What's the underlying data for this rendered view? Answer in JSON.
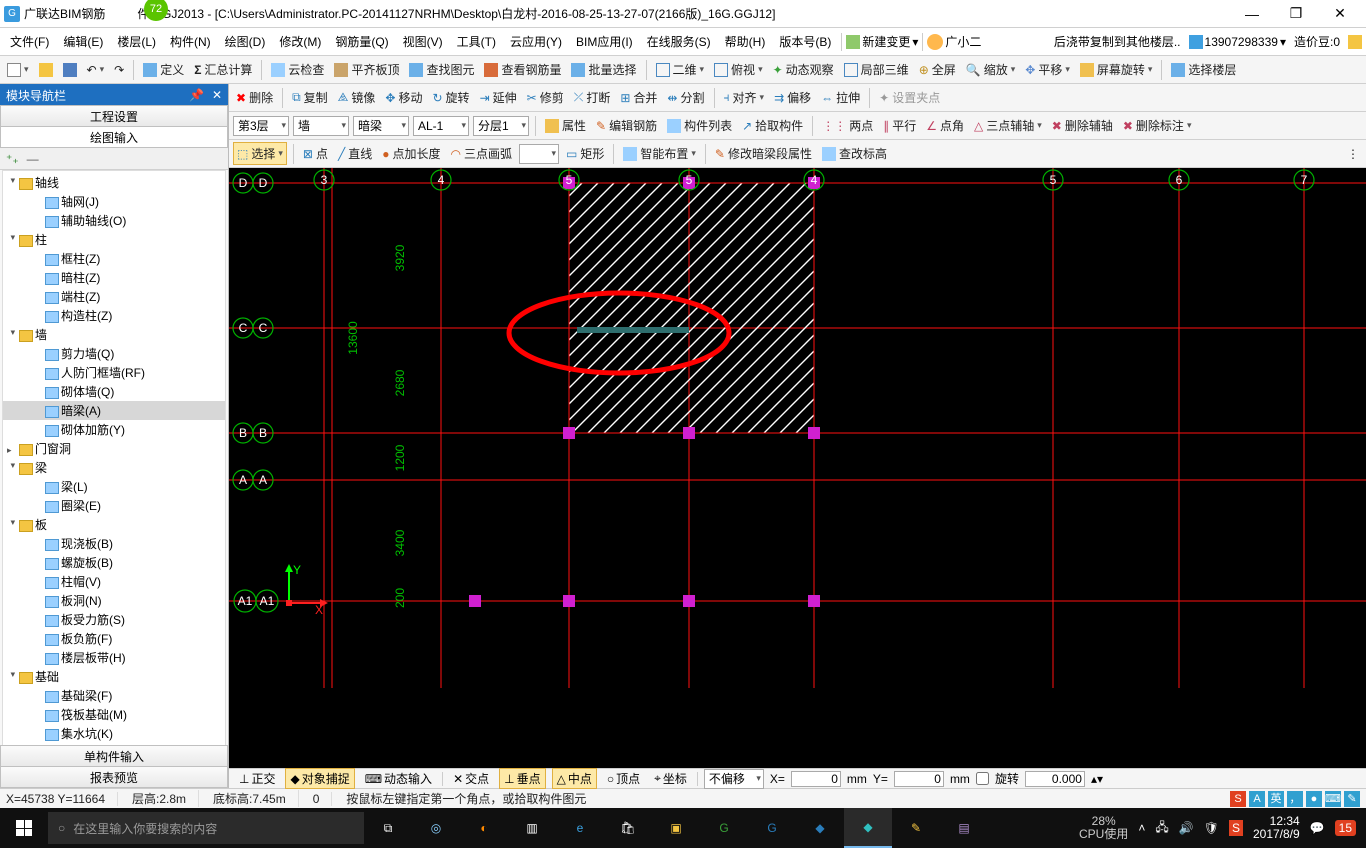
{
  "title": {
    "app": "广联达BIM钢筋",
    "suffix": "件 GGJ2013 - [C:\\Users\\Administrator.PC-20141127NRHM\\Desktop\\白龙村-2016-08-25-13-27-07(2166版)_16G.GGJ12]",
    "fps": "72"
  },
  "window_controls": {
    "min": "—",
    "max": "❐",
    "close": "✕"
  },
  "menu": {
    "items": [
      "文件(F)",
      "编辑(E)",
      "楼层(L)",
      "构件(N)",
      "绘图(D)",
      "修改(M)",
      "钢筋量(Q)",
      "视图(V)",
      "工具(T)",
      "云应用(Y)",
      "BIM应用(I)",
      "在线服务(S)",
      "帮助(H)",
      "版本号(B)"
    ],
    "new_change": "新建变更",
    "user": "广小二",
    "post_copy": "后浇带复制到其他楼层..",
    "phone": "13907298339",
    "credit_label": "造价豆:",
    "credit_val": "0"
  },
  "tb1": {
    "define": "定义",
    "sum": "汇总计算",
    "cloud": "云检查",
    "flat": "平齐板顶",
    "find": "查找图元",
    "view_rebar": "查看钢筋量",
    "batch": "批量选择",
    "v2d": "二维",
    "top": "俯视",
    "dyn": "动态观察",
    "local3d": "局部三维",
    "full": "全屏",
    "zoom": "缩放",
    "pan": "平移",
    "screen_rot": "屏幕旋转",
    "sel_floor": "选择楼层"
  },
  "tb2": {
    "del": "删除",
    "copy": "复制",
    "mirror": "镜像",
    "move": "移动",
    "rotate": "旋转",
    "extend": "延伸",
    "trim": "修剪",
    "break_": "打断",
    "merge": "合并",
    "split": "分割",
    "align": "对齐",
    "offset": "偏移",
    "stretch": "拉伸",
    "set_grip": "设置夹点"
  },
  "tb3": {
    "floor": "第3层",
    "cat": "墙",
    "subcat": "暗梁",
    "member": "AL-1",
    "layer": "分层1",
    "attr": "属性",
    "edit_rebar": "编辑钢筋",
    "member_list": "构件列表",
    "pick": "拾取构件",
    "two_pt": "两点",
    "parallel": "平行",
    "pt_angle": "点角",
    "three_aux": "三点辅轴",
    "del_aux": "删除辅轴",
    "del_label": "删除标注"
  },
  "tb4": {
    "select": "选择",
    "point": "点",
    "line": "直线",
    "pt_len": "点加长度",
    "arc3": "三点画弧",
    "rect": "矩形",
    "smart": "智能布置",
    "modify_attr": "修改暗梁段属性",
    "view_label": "查改标高"
  },
  "left": {
    "panel_title": "模块导航栏",
    "tabs": {
      "proj": "工程设置",
      "draw": "绘图输入",
      "single": "单构件输入",
      "report": "报表预览"
    }
  },
  "tree": {
    "axis": "轴线",
    "axis_grid": "轴网(J)",
    "aux_axis": "辅助轴线(O)",
    "column": "柱",
    "frame_col": "框柱(Z)",
    "hidden_col": "暗柱(Z)",
    "end_col": "端柱(Z)",
    "constr_col": "构造柱(Z)",
    "wall": "墙",
    "shear_wall": "剪力墙(Q)",
    "rf_wall": "人防门框墙(RF)",
    "masonry": "砌体墙(Q)",
    "hidden_beam": "暗梁(A)",
    "masonry_rebar": "砌体加筋(Y)",
    "opening": "门窗洞",
    "beam": "梁",
    "beam_l": "梁(L)",
    "ring_beam": "圈梁(E)",
    "slab": "板",
    "cast_slab": "现浇板(B)",
    "spiral_slab": "螺旋板(B)",
    "cap": "柱帽(V)",
    "slab_hole": "板洞(N)",
    "slab_bar": "板受力筋(S)",
    "neg_bar": "板负筋(F)",
    "floor_band": "楼层板带(H)",
    "foundation": "基础",
    "found_beam": "基础梁(F)",
    "raft": "筏板基础(M)",
    "sump": "集水坑(K)"
  },
  "axes": {
    "h": [
      "D",
      "C",
      "B",
      "A",
      "A1"
    ],
    "v": [
      "3",
      "4",
      "5",
      "6",
      "7"
    ],
    "dims_v": [
      "3920",
      "13600",
      "2680",
      "1200",
      "3400",
      "200"
    ]
  },
  "snap": {
    "ortho": "正交",
    "osnap": "对象捕捉",
    "dyn_in": "动态输入",
    "inter": "交点",
    "perp": "垂点",
    "mid": "中点",
    "apex": "顶点",
    "coord": "坐标",
    "no_off": "不偏移",
    "x_label": "X=",
    "y_label": "Y=",
    "mm": "mm",
    "rot_chk": "旋转",
    "x_val": "0",
    "y_val": "0",
    "rot_val": "0.000"
  },
  "status": {
    "coord": "X=45738 Y=11664",
    "floor_h": "层高:2.8m",
    "bottom_h": "底标高:7.45m",
    "zero": "0",
    "hint": "按鼠标左键指定第一个角点，或拾取构件图元"
  },
  "taskbar": {
    "search_ph": "在这里输入你要搜索的内容",
    "cpu_pct": "28%",
    "cpu_lbl": "CPU使用",
    "time": "12:34",
    "date": "2017/8/9",
    "badge": "15"
  }
}
